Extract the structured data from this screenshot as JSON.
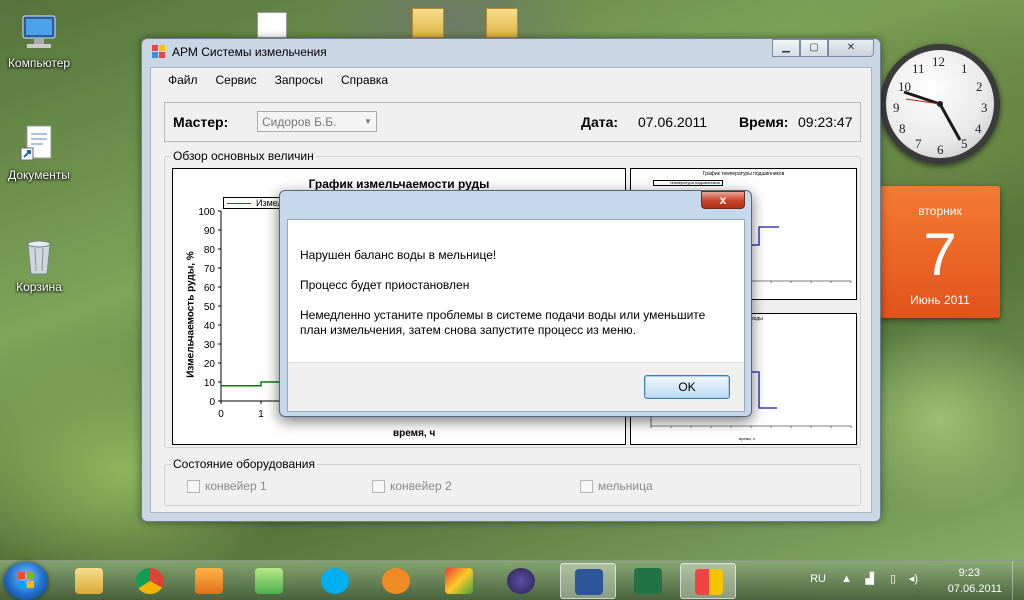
{
  "desktop": {
    "icons": [
      {
        "label": "Компьютер"
      },
      {
        "label": "Документы"
      },
      {
        "label": "Корзина"
      }
    ]
  },
  "gadgets": {
    "clock": {
      "numbers": [
        "12",
        "1",
        "2",
        "3",
        "4",
        "5",
        "6",
        "7",
        "8",
        "9",
        "10",
        "11"
      ],
      "time": "9:23"
    },
    "calendar": {
      "weekday": "вторник",
      "day": "7",
      "month_year": "Июнь 2011"
    }
  },
  "window": {
    "title": "АРМ Системы измельчения",
    "menu": [
      "Файл",
      "Сервис",
      "Запросы",
      "Справка"
    ],
    "master_label": "Мастер:",
    "master_value": "Сидоров Б.Б.",
    "date_label": "Дата:",
    "date_value": "07.06.2011",
    "time_label": "Время:",
    "time_value": "09:23:47",
    "overview_title": "Обзор основных величин",
    "equipment_title": "Состояние оборудования",
    "checkboxes": [
      "конвейер 1",
      "конвейер 2",
      "мельница"
    ]
  },
  "chart_data": [
    {
      "type": "line",
      "title": "График измельчаемости руды",
      "xlabel": "время, ч",
      "ylabel": "Измельчаемость руды, %",
      "ylim": [
        0,
        100
      ],
      "yticks": [
        "0",
        "10",
        "20",
        "30",
        "40",
        "50",
        "60",
        "70",
        "80",
        "90",
        "100"
      ],
      "xticks": [
        "0",
        "1"
      ],
      "legend": "Измел",
      "series": [
        {
          "x": [
            0,
            1,
            1,
            1.5
          ],
          "y": [
            8,
            8,
            10,
            10
          ]
        }
      ]
    },
    {
      "type": "line",
      "title": "График температуры подшипников",
      "legend": "температура подшипников",
      "xlabel": "время, ч",
      "series": [
        {
          "x": [
            3.4,
            4.5,
            4.5,
            5.4,
            5.4,
            6.4
          ],
          "y": [
            60,
            60,
            40,
            40,
            60,
            60
          ]
        }
      ]
    },
    {
      "type": "line",
      "title": "воды",
      "xlabel": "время, ч",
      "series": [
        {
          "x": [
            3.4,
            4.3,
            4.3,
            5.4,
            5.4,
            6.3
          ],
          "y": [
            30,
            30,
            60,
            60,
            20,
            20
          ]
        }
      ]
    }
  ],
  "dialog": {
    "close_label": "x",
    "line1": "Нарушен баланс воды в мельнице!",
    "line2": "Процесс будет приостановлен",
    "line3": "Немедленно устаните проблемы в системе подачи воды или уменьшите план измельчения, затем снова запустите процесс из меню.",
    "ok_label": "OK"
  },
  "taskbar": {
    "lang": "RU",
    "time": "9:23",
    "date": "07.06.2011",
    "apps": [
      "explorer-icon",
      "chrome-icon",
      "media-player-icon",
      "utility-icon",
      "skype-icon",
      "app-icon",
      "chart-app-icon",
      "eclipse-icon",
      "word-icon",
      "excel-icon",
      "arm-app-icon"
    ]
  }
}
